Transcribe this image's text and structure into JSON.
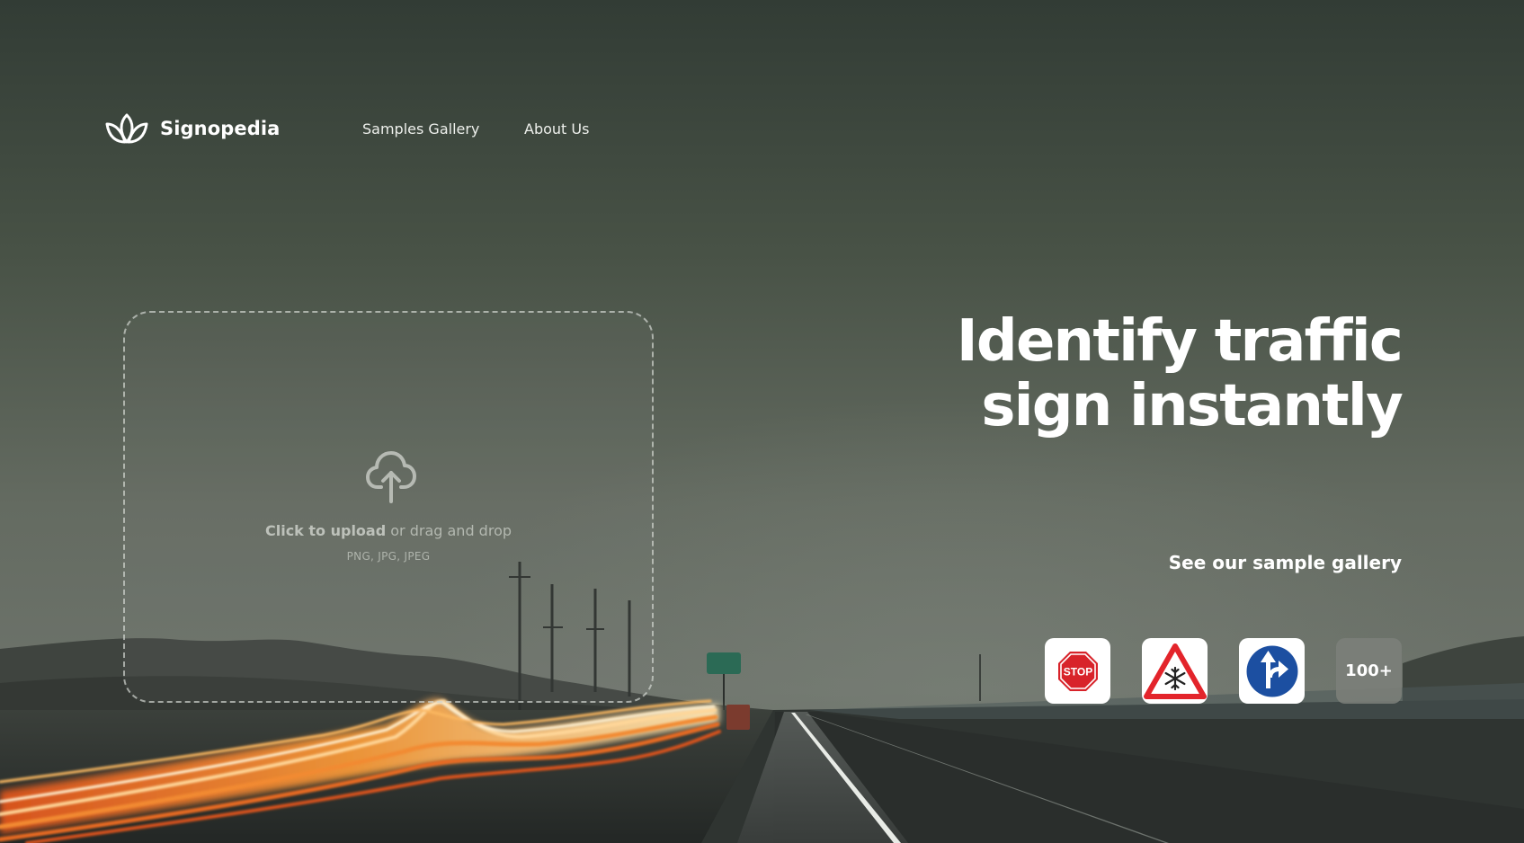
{
  "brand": {
    "name": "Signopedia",
    "logo_icon": "lotus-leaves-icon"
  },
  "nav": {
    "items": [
      {
        "label": "Samples Gallery"
      },
      {
        "label": "About Us"
      }
    ]
  },
  "upload": {
    "icon": "cloud-upload-icon",
    "cta_strong": "Click to upload",
    "cta_rest": " or drag and drop",
    "formats": "PNG, JPG, JPEG"
  },
  "hero": {
    "headline_line1": "Identify traffic",
    "headline_line2": "sign instantly",
    "gallery_link": "See our sample gallery"
  },
  "samples": {
    "tiles": [
      {
        "icon": "stop-sign-icon",
        "sign_text": "STOP"
      },
      {
        "icon": "snow-warning-sign-icon"
      },
      {
        "icon": "straight-or-right-sign-icon"
      }
    ],
    "more_label": "100+"
  },
  "colors": {
    "stop_red": "#d8232a",
    "warning_red": "#e3242b",
    "mandatory_blue": "#1c4fa1",
    "text_white": "#ffffff"
  }
}
